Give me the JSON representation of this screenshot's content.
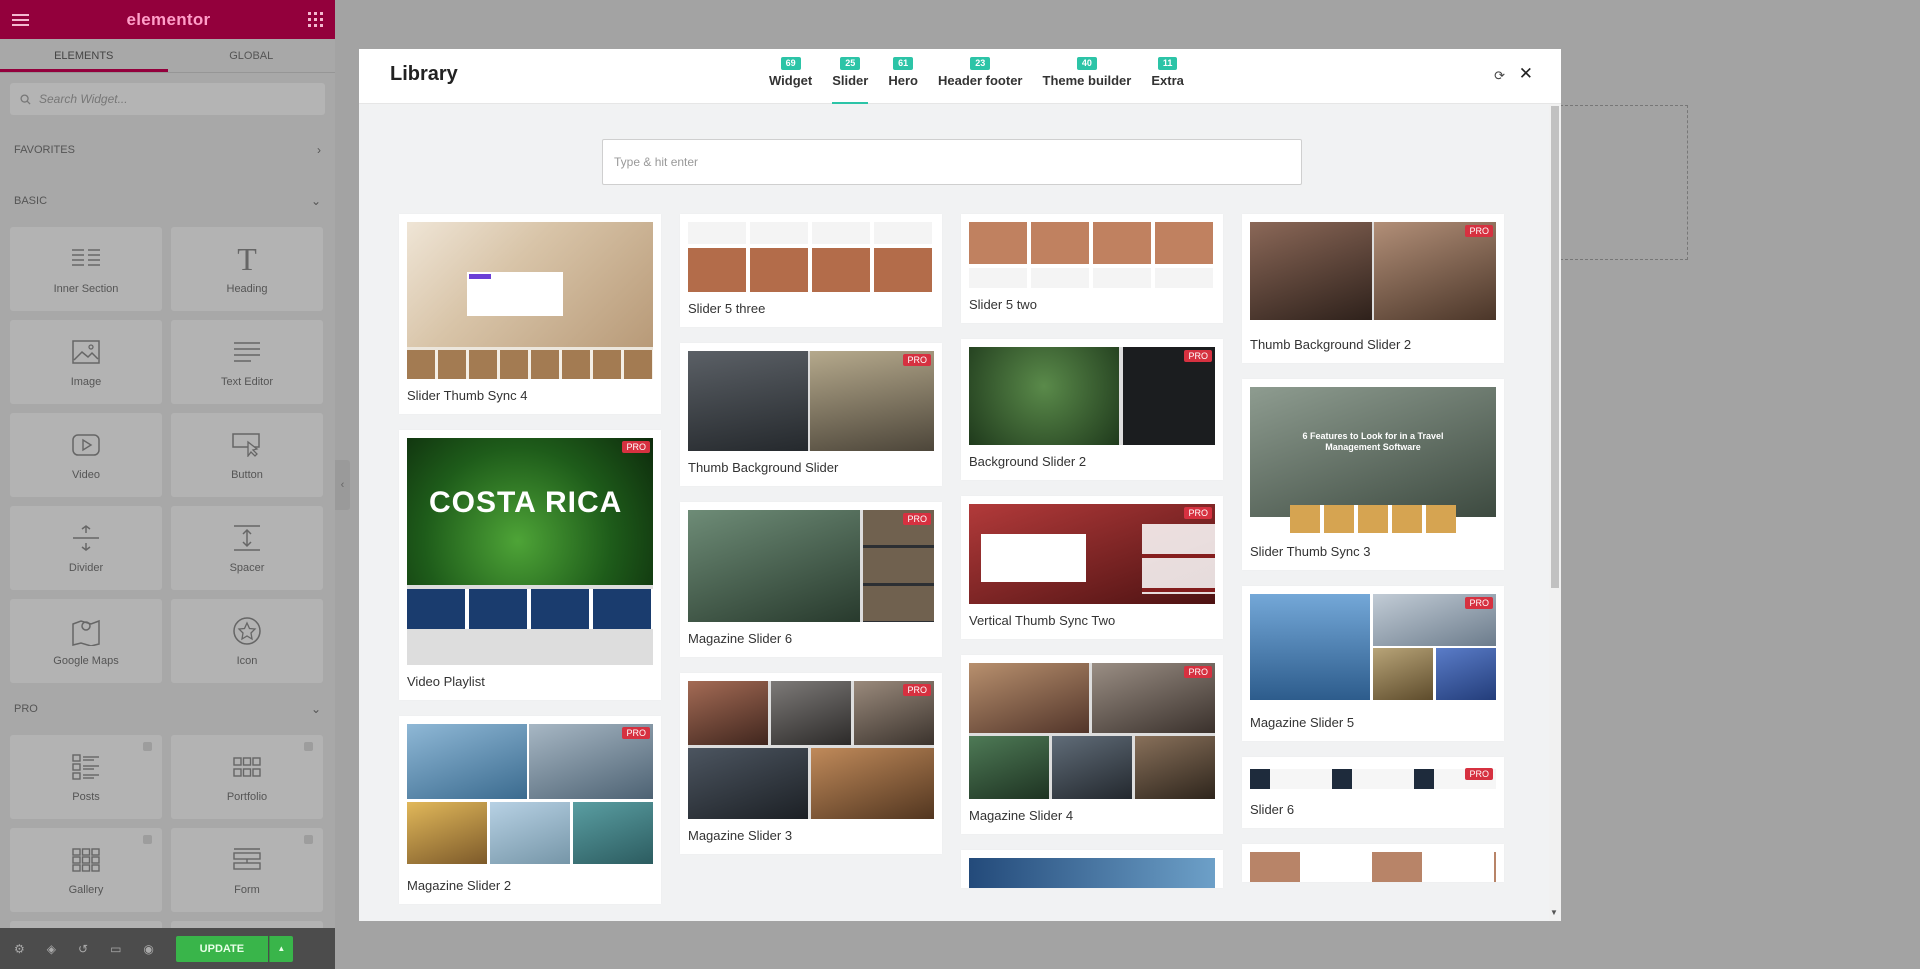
{
  "sidebar": {
    "brand": "elementor",
    "tabs": [
      "ELEMENTS",
      "GLOBAL"
    ],
    "search_placeholder": "Search Widget...",
    "sections": {
      "favorites": "FAVORITES",
      "basic": "BASIC",
      "pro": "PRO"
    },
    "basic_widgets": [
      {
        "label": "Inner Section",
        "icon": "inner-section-icon"
      },
      {
        "label": "Heading",
        "icon": "heading-icon"
      },
      {
        "label": "Image",
        "icon": "image-icon"
      },
      {
        "label": "Text Editor",
        "icon": "text-editor-icon"
      },
      {
        "label": "Video",
        "icon": "video-icon"
      },
      {
        "label": "Button",
        "icon": "button-icon"
      },
      {
        "label": "Divider",
        "icon": "divider-icon"
      },
      {
        "label": "Spacer",
        "icon": "spacer-icon"
      },
      {
        "label": "Google Maps",
        "icon": "map-icon"
      },
      {
        "label": "Icon",
        "icon": "star-icon"
      }
    ],
    "pro_widgets": [
      {
        "label": "Posts",
        "icon": "posts-icon"
      },
      {
        "label": "Portfolio",
        "icon": "portfolio-icon"
      },
      {
        "label": "Gallery",
        "icon": "gallery-icon"
      },
      {
        "label": "Form",
        "icon": "form-icon"
      }
    ],
    "footer": {
      "update_label": "UPDATE"
    }
  },
  "library": {
    "title": "Library",
    "tabs": [
      {
        "label": "Widget",
        "count": "69"
      },
      {
        "label": "Slider",
        "count": "25"
      },
      {
        "label": "Hero",
        "count": "61"
      },
      {
        "label": "Header footer",
        "count": "23"
      },
      {
        "label": "Theme builder",
        "count": "40"
      },
      {
        "label": "Extra",
        "count": "11"
      }
    ],
    "active_tab": "Slider",
    "search_placeholder": "Type & hit enter",
    "pro_label": "PRO",
    "columns": [
      [
        {
          "title": "Slider Thumb Sync 4",
          "pro": false
        },
        {
          "title": "Video Playlist",
          "pro": true,
          "thumb_text": "COSTA RICA"
        },
        {
          "title": "Magazine Slider 2",
          "pro": true
        }
      ],
      [
        {
          "title": "Slider 5 three",
          "pro": false
        },
        {
          "title": "Thumb Background Slider",
          "pro": true
        },
        {
          "title": "Magazine Slider 6",
          "pro": true
        },
        {
          "title": "Magazine Slider 3",
          "pro": true
        }
      ],
      [
        {
          "title": "Slider 5 two",
          "pro": false
        },
        {
          "title": "Background Slider 2",
          "pro": true
        },
        {
          "title": "Vertical Thumb Sync Two",
          "pro": true
        },
        {
          "title": "Magazine Slider 4",
          "pro": true
        }
      ],
      [
        {
          "title": "Thumb Background Slider 2",
          "pro": true
        },
        {
          "title": "Slider Thumb Sync 3",
          "pro": false,
          "thumb_text": "6 Features to Look for in a Travel Management Software"
        },
        {
          "title": "Magazine Slider 5",
          "pro": true
        },
        {
          "title": "Slider 6",
          "pro": true
        }
      ]
    ]
  },
  "colors": {
    "brand": "#93003c",
    "accent": "#2cc4a7",
    "pro_badge": "#d63140",
    "update_button": "#39b54a"
  }
}
